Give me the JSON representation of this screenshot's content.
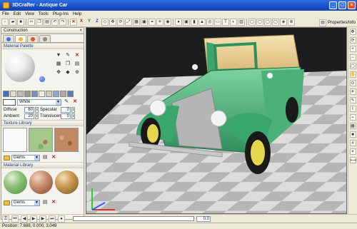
{
  "window": {
    "title": "3DCrafter - Antique Car"
  },
  "menu": [
    "File",
    "Edit",
    "View",
    "Tools",
    "Plug-Ins",
    "Help"
  ],
  "toolbar": {
    "axes": [
      "X",
      "Y",
      "Z"
    ],
    "properties_label": "Properties/Info"
  },
  "panel": {
    "title": "Construction",
    "material_palette": {
      "title": "Material Palette"
    },
    "color_name": "White",
    "params": [
      {
        "label": "Diffuse",
        "value": "60"
      },
      {
        "label": "Specular",
        "value": "0"
      },
      {
        "label": "Ambient",
        "value": "20"
      },
      {
        "label": "Translucent",
        "value": "0"
      }
    ],
    "texture_library": {
      "title": "Texture Library",
      "folder": "Gems"
    },
    "material_library": {
      "title": "Material Library",
      "folder": "Gems"
    }
  },
  "timeline": {
    "frame": "0.0"
  },
  "status": {
    "position": "Position: 7.688, 0.000, 3.049"
  }
}
